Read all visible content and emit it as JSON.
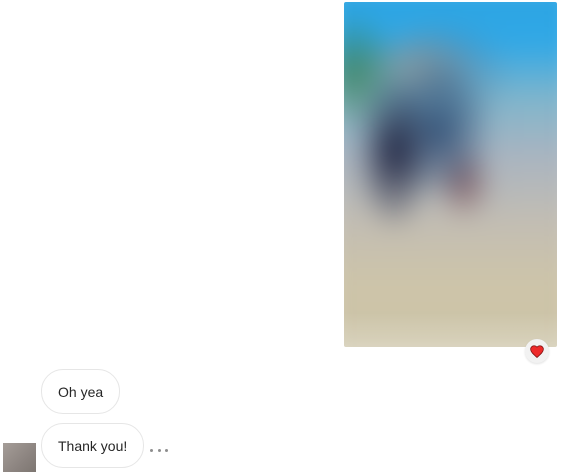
{
  "conversation": {
    "photo_message": {
      "icon": "blurred-photo",
      "reaction": "heart-icon",
      "reaction_color": "#ed4956"
    },
    "messages": [
      {
        "text": "Oh yea"
      },
      {
        "text": "Thank you!"
      }
    ],
    "more_options_icon": "ellipsis-icon",
    "avatar_icon": "avatar"
  }
}
